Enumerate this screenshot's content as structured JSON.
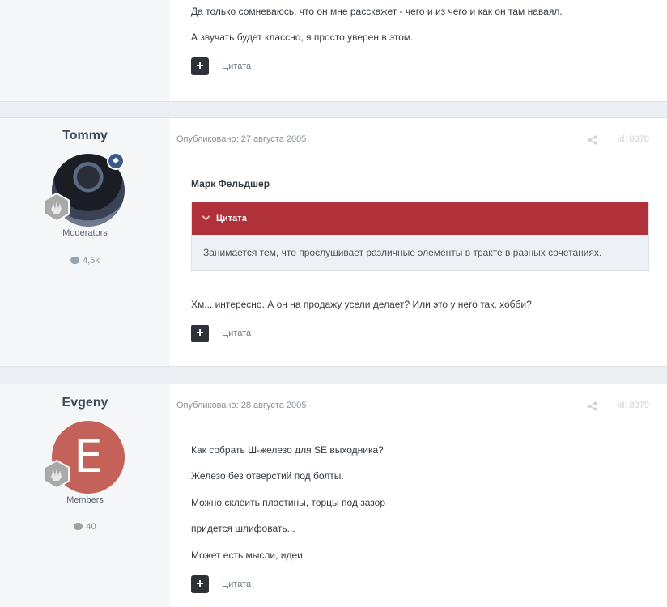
{
  "posts": [
    {
      "lines": [
        "Да только сомневаюсь, что он мне расскажет - чего и из чего и как он там наваял.",
        "А звучать будет классно, я просто уверен в этом."
      ],
      "quote_action": "Цитата"
    },
    {
      "author": "Tommy",
      "group": "Moderators",
      "post_count": "4,5k",
      "published": "Опубликовано: 27 августа 2005",
      "id": "id: 8370",
      "quote_author": "Марк Фельдшер",
      "quote_title": "Цитата",
      "quote_text": "Занимается тем, что прослушивает различные элементы в тракте в разных сочетаниях.",
      "reply": "Хм... интересно. А он на продажу усели делает? Или это у него так, хобби?",
      "quote_action": "Цитата"
    },
    {
      "author": "Evgeny",
      "avatar_letter": "E",
      "group": "Members",
      "post_count": "40",
      "published": "Опубликовано: 28 августа 2005",
      "id": "id: 8379",
      "lines": [
        "Как собрать Ш-железо для SE выходника?",
        "Железо без отверстий под болты.",
        "Можно склеить пластины, торцы под зазор",
        "придется шлифовать...",
        "Может есть мысли, идеи."
      ],
      "quote_action": "Цитата"
    }
  ],
  "icons": {
    "share": "share-icon",
    "comment": "comment-icon",
    "rank": "rank-hand-icon",
    "moderator": "shield-icon",
    "collapse": "chevron-down-icon",
    "add_quote": "plus-icon"
  },
  "colors": {
    "quote_header": "#b1313b",
    "moderator_badge": "#3e5a8c",
    "avatar_evgeny": "#c4625a"
  }
}
